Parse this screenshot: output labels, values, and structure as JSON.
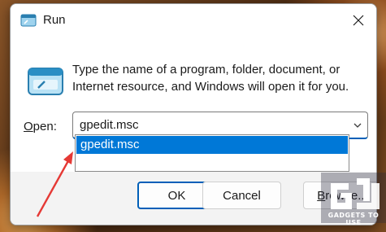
{
  "window": {
    "title": "Run",
    "title_icon": "run-icon",
    "close_icon": "close-icon"
  },
  "content": {
    "description": "Type the name of a program, folder, document, or Internet resource, and Windows will open it for you.",
    "open_label_prefix": "",
    "open_label_underlined": "O",
    "open_label_rest": "pen:",
    "input_value": "gpedit.msc",
    "dropdown_items": [
      "gpedit.msc"
    ]
  },
  "buttons": {
    "ok": "OK",
    "cancel": "Cancel",
    "browse_underlined": "B",
    "browse_rest": "rowse..."
  },
  "watermark": {
    "text": "GADGETS TO USE"
  },
  "colors": {
    "accent": "#005fb8",
    "selection": "#0078d7",
    "annotation_arrow": "#e53935"
  }
}
